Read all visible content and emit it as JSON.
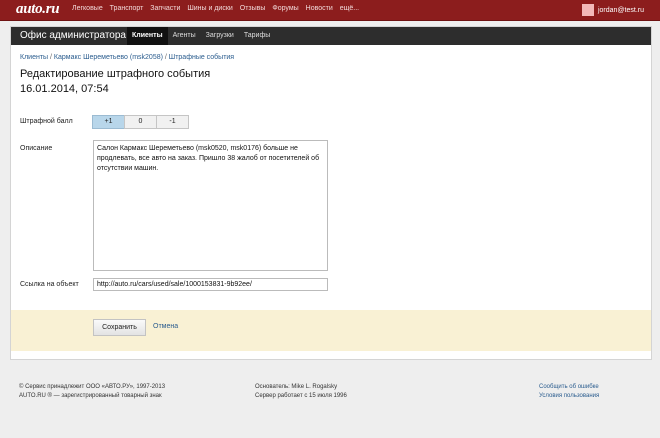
{
  "topbar": {
    "logo": "auto.ru",
    "nav": [
      "Легковые",
      "Транспорт",
      "Запчасти",
      "Шины и диски",
      "Отзывы",
      "Форумы",
      "Новости",
      "ещё..."
    ],
    "user": "jordan@test.ru"
  },
  "admin": {
    "title": "Офис администратора",
    "tabs": [
      "Клиенты",
      "Агенты",
      "Загрузки",
      "Тарифы"
    ]
  },
  "breadcrumb": {
    "items": [
      "Клиенты",
      "Кармакс Шереметьево (msk2058)",
      "Штрафные события"
    ]
  },
  "page": {
    "title_line1": "Редактирование штрафного события",
    "title_line2": "16.01.2014, 07:54"
  },
  "form": {
    "penalty_label": "Штрафной балл",
    "penalty_options": [
      "+1",
      "0",
      "-1"
    ],
    "description_label": "Описание",
    "description_value": "Салон Кармакс Шереметьево (msk0520, msk0176) больше не продлевать, все авто на заказ. Пришло 38 жалоб от посетителей об отсутствии машин.",
    "link_label": "Ссылка на объект",
    "link_value": "http://auto.ru/cars/used/sale/1000153831-9b92ee/",
    "save_label": "Сохранить",
    "cancel_label": "Отмена"
  },
  "footer": {
    "left1": "© Сервис принадлежит ООО «АВТО.РУ», 1997-2013",
    "left2": "AUTO.RU ® — зарегистрированный товарный знак",
    "mid1": "Основатель: Mike L. Rogalsky",
    "mid2": "Сервер работает с 15 июля 1996",
    "right1": "Сообщить об ошибке",
    "right2": "Условия пользования"
  }
}
